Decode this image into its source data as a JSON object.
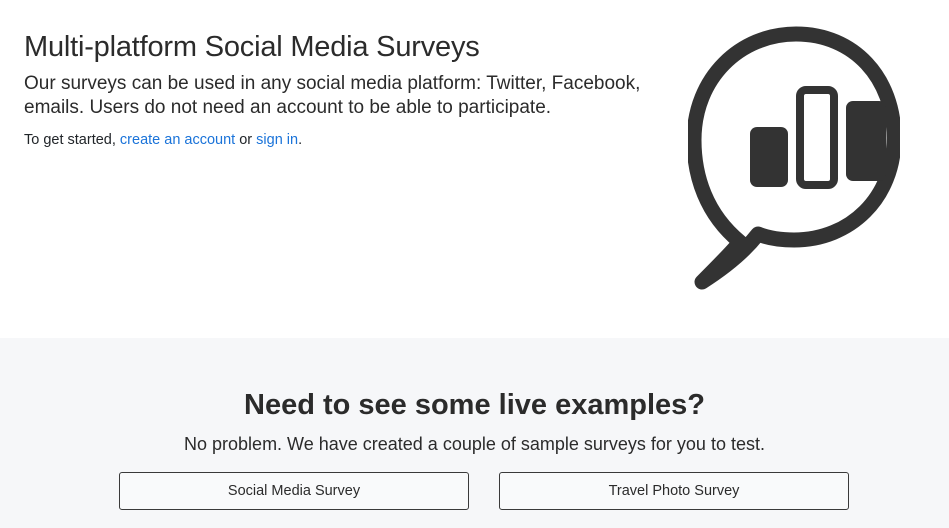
{
  "hero": {
    "title": "Multi-platform Social Media Surveys",
    "lead": "Our surveys can be used in any social media platform: Twitter, Facebook, emails. Users do not need an account to be able to participate.",
    "get_started_prefix": "To get started, ",
    "create_account_link": "create an account",
    "or_text": " or ",
    "sign_in_link": "sign in",
    "suffix": ".",
    "logo_icon": "speech-bubble-bar-chart-icon"
  },
  "examples": {
    "title": "Need to see some live examples?",
    "subtitle": "No problem. We have created a couple of sample surveys for you to test.",
    "buttons": [
      {
        "label": "Social Media Survey"
      },
      {
        "label": "Travel Photo Survey"
      }
    ]
  },
  "colors": {
    "link": "#1a73d9",
    "logo": "#333333",
    "section_bg": "#f6f7f9"
  }
}
